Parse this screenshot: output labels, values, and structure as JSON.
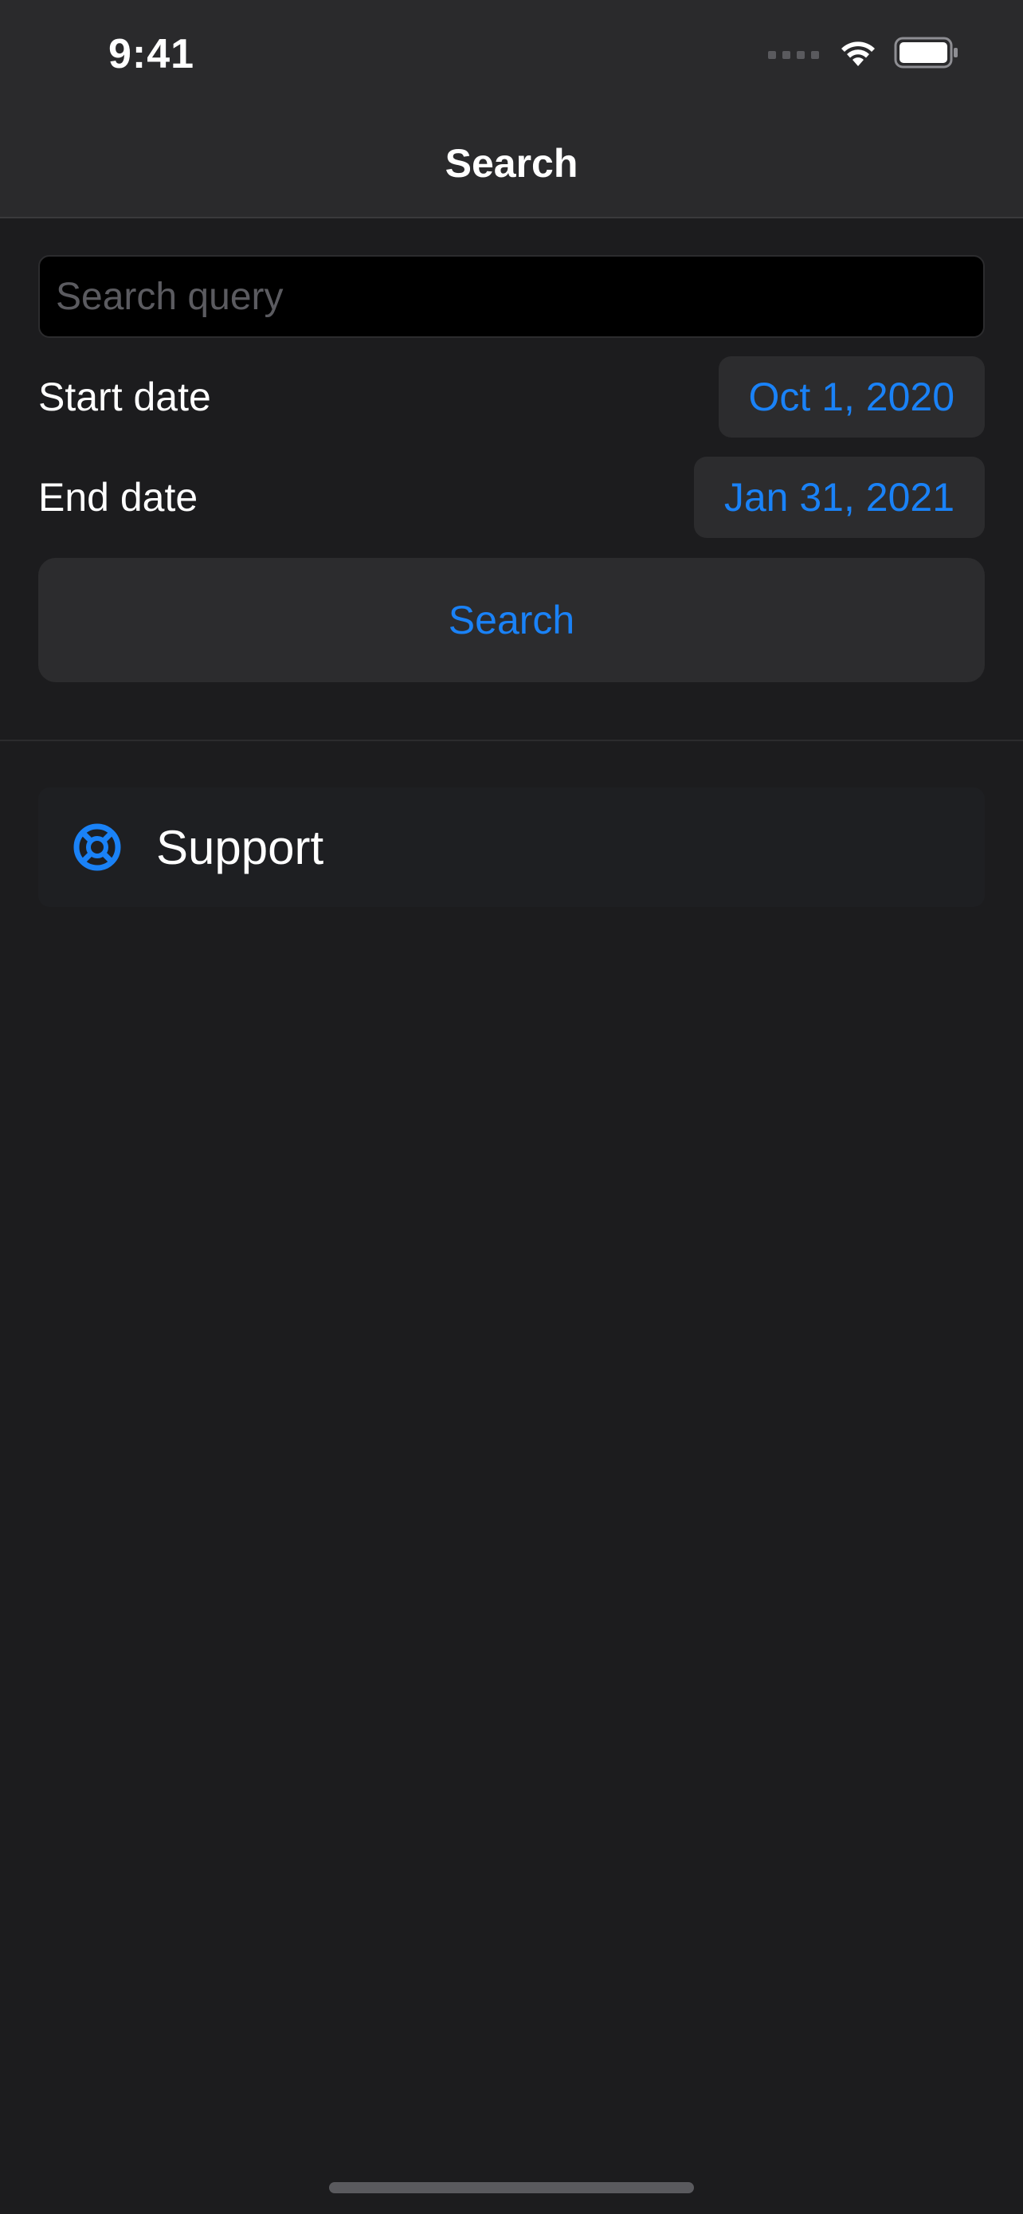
{
  "status_bar": {
    "time": "9:41",
    "icons": [
      "cellular-signal-icon",
      "wifi-icon",
      "battery-icon"
    ]
  },
  "nav": {
    "title": "Search"
  },
  "search": {
    "placeholder": "Search query",
    "value": ""
  },
  "start_date": {
    "label": "Start date",
    "value": "Oct 1, 2020"
  },
  "end_date": {
    "label": "End date",
    "value": "Jan 31, 2021"
  },
  "search_button": {
    "label": "Search"
  },
  "support": {
    "label": "Support",
    "icon": "lifebuoy-icon"
  },
  "colors": {
    "accent": "#1a82f7",
    "background": "#1c1c1e",
    "card": "#2c2c2e"
  }
}
